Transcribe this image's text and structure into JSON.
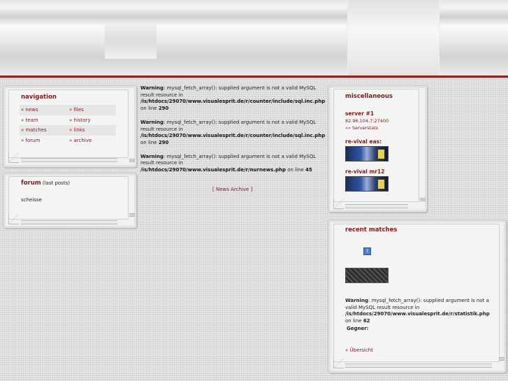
{
  "nav": {
    "title": "navigation",
    "items": [
      {
        "left": "» news",
        "right": "» files"
      },
      {
        "left": "» team",
        "right": "» history"
      },
      {
        "left": "» matches",
        "right": "» links"
      },
      {
        "left": "» forum",
        "right": "» archive"
      }
    ]
  },
  "forum": {
    "title": "forum",
    "subtitle": "(last posts)",
    "post": "scheisse"
  },
  "main": {
    "warnings": [
      {
        "label": "Warning",
        "text": ": mysql_fetch_array(): supplied argument is not a valid MySQL result resource in ",
        "path": "/is/htdocs/29070/www.visualesprit.de/r/counter/include/sql.inc.php",
        "line_prefix": " on line ",
        "line": "290"
      },
      {
        "label": "Warning",
        "text": ": mysql_fetch_array(): supplied argument is not a valid MySQL result resource in ",
        "path": "/is/htdocs/29070/www.visualesprit.de/r/counter/include/sql.inc.php",
        "line_prefix": " on line ",
        "line": "290"
      },
      {
        "label": "Warning",
        "text": ": mysql_fetch_array(): supplied argument is not a valid MySQL result resource in ",
        "path": "/is/htdocs/29070/www.visualesprit.de/r/nurnews.php",
        "line_prefix": " on line ",
        "line": "45"
      }
    ],
    "archive_link": "[ News Archive ]"
  },
  "misc": {
    "title": "miscellaneous",
    "server_title": "server #1",
    "server_ip": "82.96.104.7:27400",
    "serverstats": "»» Serverstats",
    "revival_eas": "re-vival eas:",
    "revival_mr12": "re-vival mr12"
  },
  "matches": {
    "title": "recent matches",
    "warning_label": "Warning",
    "warning_text": ": mysql_fetch_array(): supplied argument is not a valid MySQL result resource in ",
    "warning_path": "/is/htdocs/29070/www.visualesprit.de/r/statistik.php",
    "line_prefix": " on line ",
    "line": "62",
    "gegner": "Gegner:",
    "ubersicht": "» Übersicht"
  },
  "colors": {
    "accent": "#7b1a1a",
    "bar": "#8e2424"
  }
}
